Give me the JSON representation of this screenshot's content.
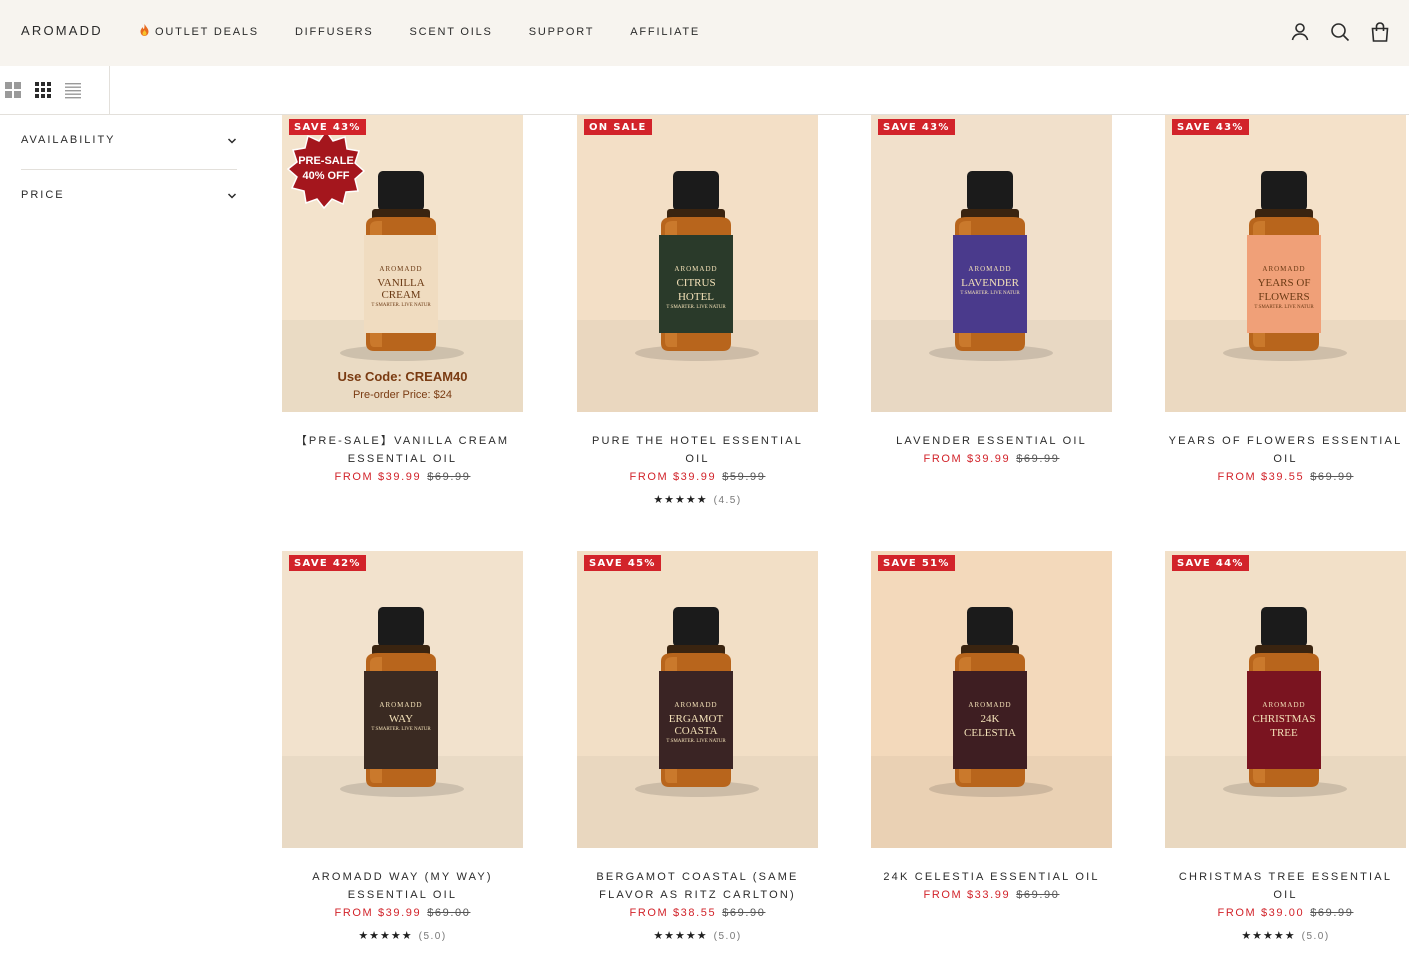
{
  "header": {
    "logo": "AROMADD",
    "nav": [
      {
        "label": "OUTLET DEALS",
        "icon": "flame-icon"
      },
      {
        "label": "DIFFUSERS"
      },
      {
        "label": "SCENT OILS"
      },
      {
        "label": "SUPPORT"
      },
      {
        "label": "AFFILIATE"
      }
    ],
    "icons": [
      "account-icon",
      "search-icon",
      "cart-icon"
    ]
  },
  "toolbar": {
    "layouts": [
      "grid-large-icon",
      "grid-small-icon",
      "list-icon"
    ]
  },
  "filters": [
    {
      "label": "AVAILABILITY"
    },
    {
      "label": "PRICE"
    }
  ],
  "products": [
    {
      "badge": "SAVE 43%",
      "title": "【PRE-SALE】VANILLA CREAM ESSENTIAL OIL",
      "price": "FROM $39.99",
      "old_price": "$69.99",
      "label_line1": "AROMADD",
      "label_line2": "VANILLA CREAM",
      "label_line3": "T SMARTER. LIVE NATUR",
      "label_color": "#f0dcc0",
      "seal_line1": "PRE-SALE",
      "seal_line2": "40% OFF",
      "promo_code": "Use Code: CREAM40",
      "promo_price": "Pre-order Price: $24"
    },
    {
      "badge": "ON SALE",
      "title": "PURE THE HOTEL ESSENTIAL OIL",
      "price": "FROM $39.99",
      "old_price": "$59.99",
      "stars": "★★★★★",
      "rating": "(4.5)",
      "label_line1": "AROMADD",
      "label_line2": "CITRUS",
      "label_line3": "HOTEL",
      "label_line4": "T SMARTER. LIVE NATUR",
      "label_color": "#2a3a2a"
    },
    {
      "badge": "SAVE 43%",
      "title": "LAVENDER ESSENTIAL OIL",
      "price": "FROM $39.99",
      "old_price": "$69.99",
      "label_line1": "AROMADD",
      "label_line2": "LAVENDER",
      "label_line3": "T SMARTER. LIVE NATUR",
      "label_color": "#4a3a8c"
    },
    {
      "badge": "SAVE 43%",
      "title": "YEARS OF FLOWERS ESSENTIAL OIL",
      "price": "FROM $39.55",
      "old_price": "$69.99",
      "label_line1": "AROMADD",
      "label_line2": "YEARS OF",
      "label_line3": "FLOWERS",
      "label_line4": "T SMARTER. LIVE NATUR",
      "label_color": "#f0a078"
    },
    {
      "badge": "SAVE 42%",
      "title": "AROMADD WAY (MY WAY) ESSENTIAL OIL",
      "price": "FROM $39.99",
      "old_price": "$69.00",
      "stars": "★★★★★",
      "rating": "(5.0)",
      "label_line1": "AROMADD",
      "label_line2": "WAY",
      "label_line3": "T SMARTER. LIVE NATUR",
      "label_color": "#3a2a22"
    },
    {
      "badge": "SAVE 45%",
      "title": "BERGAMOT COASTAL (SAME FLAVOR AS RITZ CARLTON)",
      "price": "FROM $38.55",
      "old_price": "$69.90",
      "stars": "★★★★★",
      "rating": "(5.0)",
      "label_line1": "AROMADD",
      "label_line2": "ERGAMOT COASTA",
      "label_line3": "T SMARTER. LIVE NATUR",
      "label_color": "#3a2424"
    },
    {
      "badge": "SAVE 51%",
      "title": "24K CELESTIA ESSENTIAL OIL",
      "price": "FROM $33.99",
      "old_price": "$69.90",
      "label_line1": "AROMADD",
      "label_line2": "24K",
      "label_line3": "CELESTIA",
      "label_color": "#3e1e22"
    },
    {
      "badge": "SAVE 44%",
      "title": "CHRISTMAS TREE ESSENTIAL OIL",
      "price": "FROM $39.00",
      "old_price": "$69.99",
      "stars": "★★★★★",
      "rating": "(5.0)",
      "label_line1": "AROMADD",
      "label_line2": "CHRISTMAS",
      "label_line3": "TREE",
      "label_color": "#7a1420"
    }
  ],
  "colors": {
    "accent_red": "#d2232a",
    "header_bg": "#f7f4ef",
    "image_bg": "#f1dfc8"
  }
}
